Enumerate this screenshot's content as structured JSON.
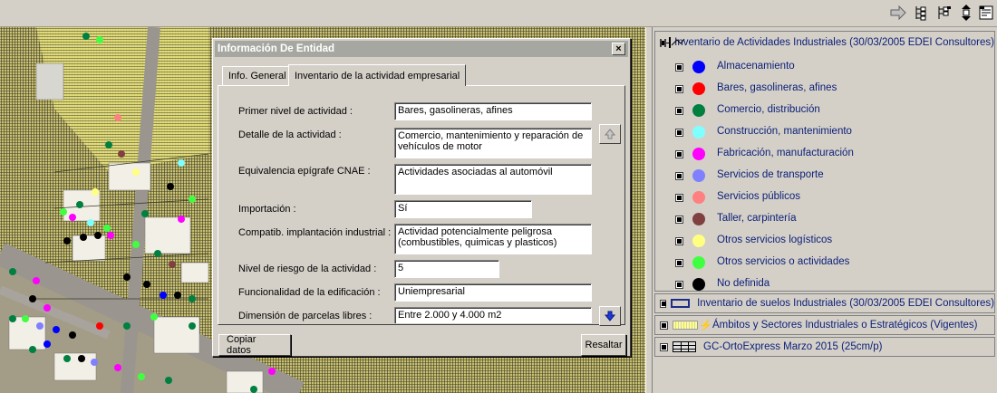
{
  "toolbar": {
    "icons": [
      "arrow-right-icon",
      "tree-expand-icon",
      "tree-collapse-icon",
      "layers-swap-icon",
      "properties-icon"
    ]
  },
  "dialog": {
    "title": "Información De Entidad",
    "close_label": "×",
    "tabs": [
      {
        "label": "Info. General",
        "active": false
      },
      {
        "label": "Inventario de la actividad empresarial",
        "active": true
      }
    ],
    "fields": [
      {
        "label": "Primer nivel de actividad :",
        "value": "Bares, gasolineras, afines"
      },
      {
        "label": "Detalle de la actividad :",
        "value": "Comercio, mantenimiento y reparación de vehículos de motor"
      },
      {
        "label": "Equivalencia epígrafe CNAE :",
        "value": "Actividades asociadas al automóvil"
      },
      {
        "label": "Importación :",
        "value": "Sí"
      },
      {
        "label": "Compatib. implantación industrial :",
        "value": "Actividad potencialmente peligrosa (combustibles, quimicas y plasticos)"
      },
      {
        "label": "Nivel de riesgo de la actividad :",
        "value": "5"
      },
      {
        "label": "Funcionalidad de la edificación :",
        "value": "Uniempresarial"
      },
      {
        "label": "Dimensión de parcelas libres :",
        "value": "Entre 2.000 y 4.000 m2"
      }
    ],
    "copy_button": "Copiar datos",
    "highlight_button": "Resaltar"
  },
  "legend": {
    "layer1": {
      "label": "Inventario de Actividades Industriales (30/03/2005 EDEI Consultores)",
      "items": [
        {
          "label": "Almacenamiento",
          "color": "#0000ff"
        },
        {
          "label": "Bares, gasolineras, afines",
          "color": "#ff0000"
        },
        {
          "label": "Comercio, distribución",
          "color": "#008040"
        },
        {
          "label": "Construcción, mantenimiento",
          "color": "#80ffff"
        },
        {
          "label": "Fabricación, manufacturación",
          "color": "#ff00ff"
        },
        {
          "label": "Servicios de transporte",
          "color": "#8080ff"
        },
        {
          "label": "Servicios públicos",
          "color": "#ff8080"
        },
        {
          "label": "Taller, carpintería",
          "color": "#804040"
        },
        {
          "label": "Otros servicios logísticos",
          "color": "#ffff80"
        },
        {
          "label": "Otros servicios o actividades",
          "color": "#40ff40"
        },
        {
          "label": "No definida",
          "color": "#000000"
        }
      ]
    },
    "layer2": {
      "label": "Inventario de suelos Industriales (30/03/2005 EDEI Consultores)"
    },
    "layer3": {
      "label": "Ámbitos y Sectores Industriales o Estratégicos (Vigentes)"
    },
    "layer4": {
      "label": "GC-OrtoExpress Marzo 2015 (25cm/p)"
    }
  }
}
